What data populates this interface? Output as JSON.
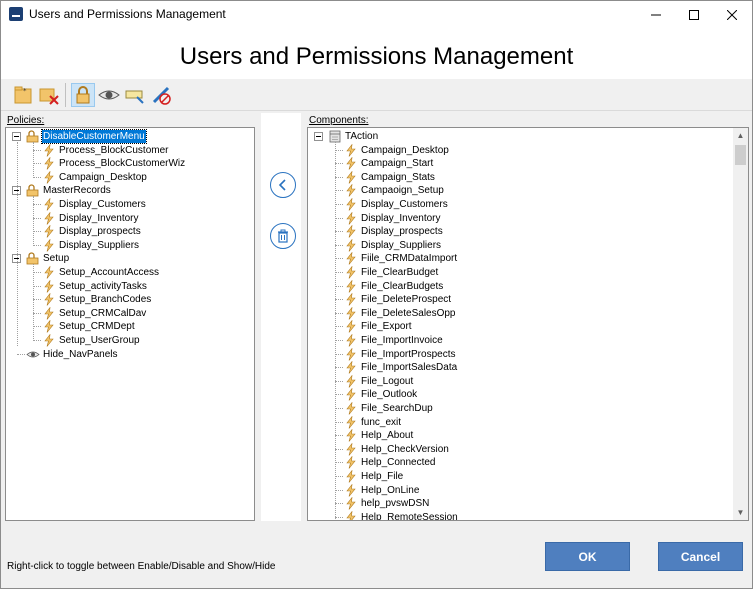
{
  "window": {
    "title": "Users and Permissions Management"
  },
  "header": {
    "heading": "Users and Permissions Management"
  },
  "toolbar": {
    "buttons": [
      {
        "icon": "add-policy-icon"
      },
      {
        "icon": "delete-policy-icon"
      },
      {
        "icon": "lock-icon",
        "active": true
      },
      {
        "icon": "eye-icon"
      },
      {
        "icon": "rename-icon"
      },
      {
        "icon": "edit-disabled-icon"
      }
    ]
  },
  "policies": {
    "label": "Policies:",
    "tree": [
      {
        "label": "DisableCustomerMenu",
        "type": "folder",
        "level": 0,
        "selected": true
      },
      {
        "label": "Process_BlockCustomer",
        "type": "action",
        "level": 1
      },
      {
        "label": "Process_BlockCustomerWiz",
        "type": "action",
        "level": 1
      },
      {
        "label": "Campaign_Desktop",
        "type": "action",
        "level": 1
      },
      {
        "label": "MasterRecords",
        "type": "folder",
        "level": 0
      },
      {
        "label": "Display_Customers",
        "type": "action",
        "level": 1
      },
      {
        "label": "Display_Inventory",
        "type": "action",
        "level": 1
      },
      {
        "label": "Display_prospects",
        "type": "action",
        "level": 1
      },
      {
        "label": "Display_Suppliers",
        "type": "action",
        "level": 1
      },
      {
        "label": "Setup",
        "type": "folder",
        "level": 0
      },
      {
        "label": "Setup_AccountAccess",
        "type": "action",
        "level": 1
      },
      {
        "label": "Setup_activityTasks",
        "type": "action",
        "level": 1
      },
      {
        "label": "Setup_BranchCodes",
        "type": "action",
        "level": 1
      },
      {
        "label": "Setup_CRMCalDav",
        "type": "action",
        "level": 1
      },
      {
        "label": "Setup_CRMDept",
        "type": "action",
        "level": 1
      },
      {
        "label": "Setup_UserGroup",
        "type": "action",
        "level": 1
      },
      {
        "label": "Hide_NavPanels",
        "type": "eye",
        "level": 0
      }
    ]
  },
  "components": {
    "label": "Components:",
    "root": "TAction",
    "items": [
      "Campaign_Desktop",
      "Campaign_Start",
      "Campaign_Stats",
      "Campaoign_Setup",
      "Display_Customers",
      "Display_Inventory",
      "Display_prospects",
      "Display_Suppliers",
      "Fiile_CRMDataImport",
      "File_ClearBudget",
      "File_ClearBudgets",
      "File_DeleteProspect",
      "File_DeleteSalesOpp",
      "File_Export",
      "File_ImportInvoice",
      "File_ImportProspects",
      "File_ImportSalesData",
      "File_Logout",
      "File_Outlook",
      "File_SearchDup",
      "func_exit",
      "Help_About",
      "Help_CheckVersion",
      "Help_Connected",
      "Help_File",
      "Help_OnLine",
      "help_pvswDSN",
      "Help_RemoteSession"
    ]
  },
  "footer": {
    "hint": "Right-click to toggle between Enable/Disable and Show/Hide",
    "ok_label": "OK",
    "cancel_label": "Cancel"
  },
  "colors": {
    "accent": "#4f7fbf",
    "selection": "#0078d7"
  }
}
